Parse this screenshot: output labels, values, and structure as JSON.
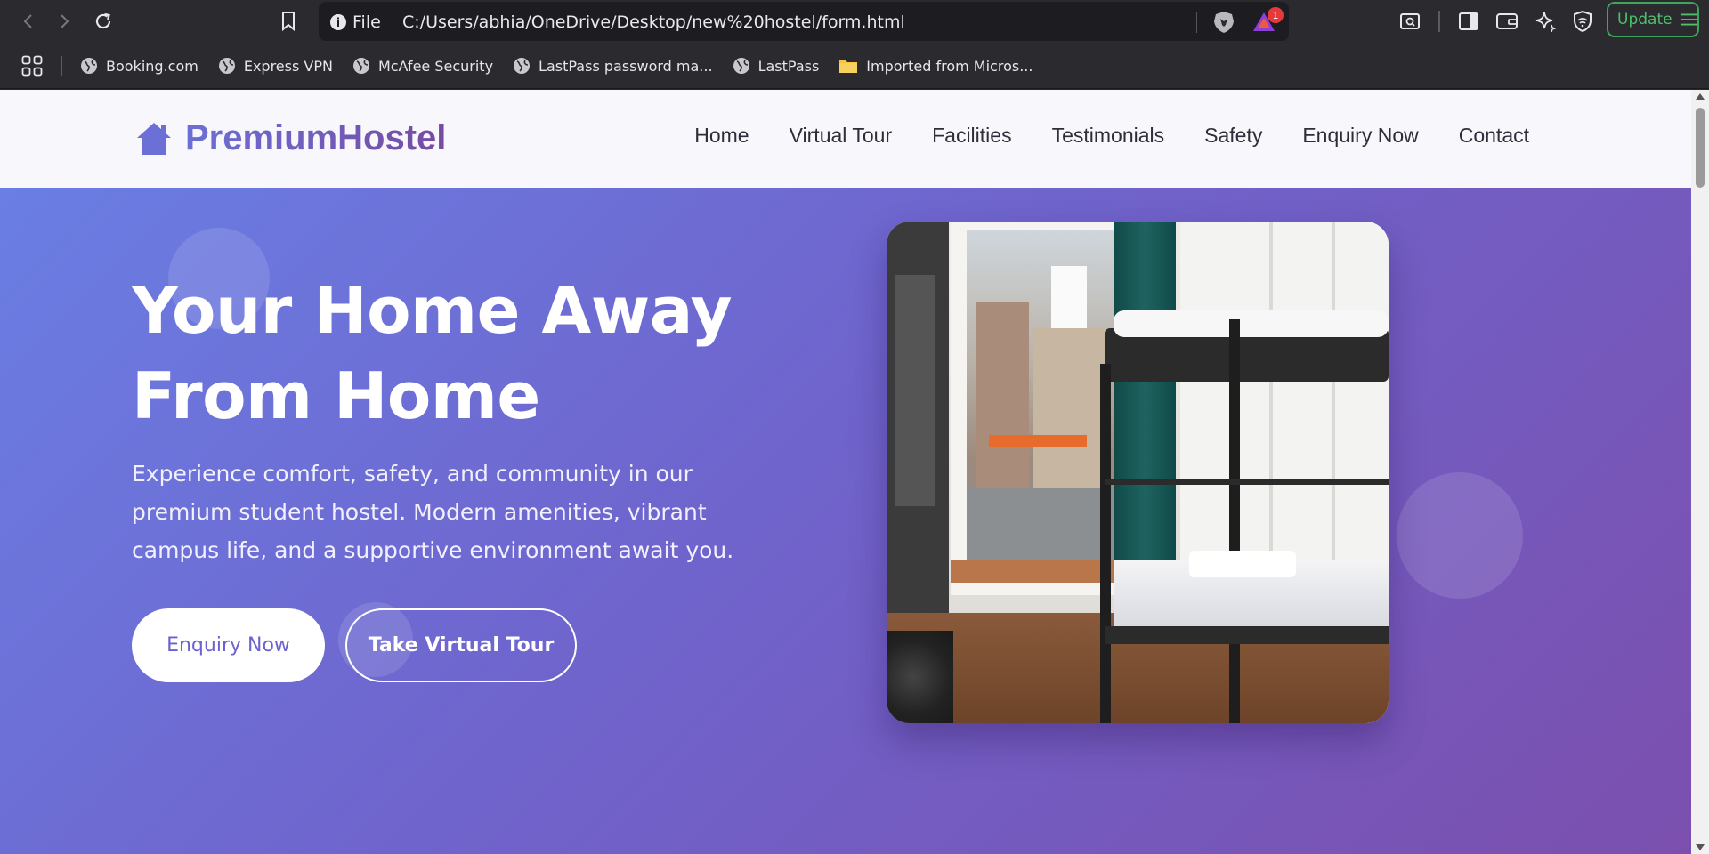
{
  "browser": {
    "url_scheme_label": "File",
    "url": "C:/Users/abhia/OneDrive/Desktop/new%20hostel/form.html",
    "rewards_badge": "1",
    "update_label": "Update",
    "bookmarks": [
      {
        "label": "Booking.com",
        "icon": "globe-icon"
      },
      {
        "label": "Express VPN",
        "icon": "globe-icon"
      },
      {
        "label": "McAfee Security",
        "icon": "globe-icon"
      },
      {
        "label": "LastPass password ma...",
        "icon": "globe-icon"
      },
      {
        "label": "LastPass",
        "icon": "globe-icon"
      },
      {
        "label": "Imported from Micros...",
        "icon": "folder-icon"
      }
    ]
  },
  "site": {
    "logo_text": "PremiumHostel",
    "nav": [
      "Home",
      "Virtual Tour",
      "Facilities",
      "Testimonials",
      "Safety",
      "Enquiry Now",
      "Contact"
    ]
  },
  "hero": {
    "title_line1": "Your Home Away",
    "title_line2": "From Home",
    "description": "Experience comfort, safety, and community in our premium student hostel. Modern amenities, vibrant campus life, and a supportive environment await you.",
    "primary_button": "Enquiry Now",
    "secondary_button": "Take Virtual Tour"
  },
  "colors": {
    "brand": "#6b62cf",
    "hero_gradient_start": "#6a7ee3",
    "hero_gradient_end": "#7b4fae",
    "update_green": "#4fbf6a"
  }
}
